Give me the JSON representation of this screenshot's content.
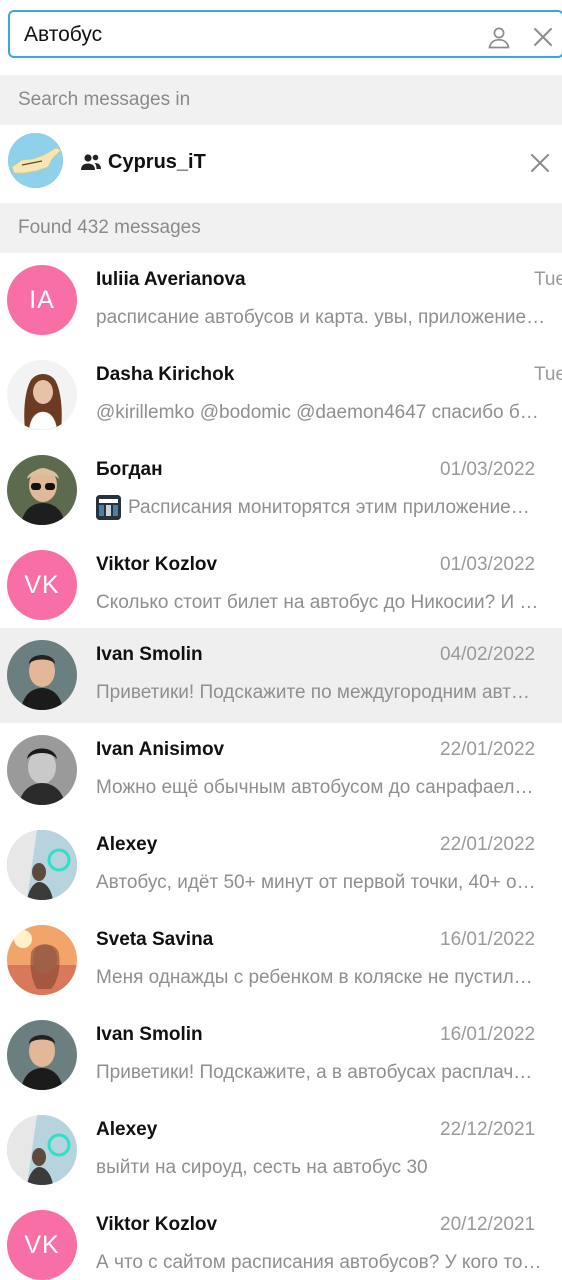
{
  "search": {
    "query": "Автобус",
    "person_icon": "person-icon",
    "clear_icon": "close-icon"
  },
  "search_in": {
    "header": "Search messages in",
    "chat_name": "Cyprus_iT",
    "group_icon": "group-icon",
    "remove_icon": "close-icon"
  },
  "results": {
    "header": "Found 432 messages",
    "items": [
      {
        "name": "Iuliia Averianova",
        "date": "Tue",
        "text": "расписание автобусов и карта. увы, приложение…",
        "avatar": "initials",
        "initials": "IA",
        "avatar_color": "#f76fa5"
      },
      {
        "name": "Dasha Kirichok",
        "date": "Tue",
        "text": "@kirillemko @bodomic @daemon4647 спасибо б…",
        "avatar": "photo"
      },
      {
        "name": "Богдан",
        "date": "01/03/2022",
        "text": "Расписания мониторятся этим приложение…",
        "avatar": "photo",
        "has_thumb": true
      },
      {
        "name": "Viktor Kozlov",
        "date": "01/03/2022",
        "text": "Сколько стоит билет на автобус до Никосии? И …",
        "avatar": "initials",
        "initials": "VK",
        "avatar_color": "#f76fa5"
      },
      {
        "name": "Ivan Smolin",
        "date": "04/02/2022",
        "text": "Приветики! Подскажите по междугородним авт…",
        "avatar": "photo",
        "active": true
      },
      {
        "name": "Ivan Anisimov",
        "date": "22/01/2022",
        "text": "Можно ещё обычным автобусом до санрафаел…",
        "avatar": "photo"
      },
      {
        "name": "Alexey",
        "date": "22/01/2022",
        "text": "Автобус, идёт 50+ минут от первой точки, 40+ о…",
        "avatar": "photo"
      },
      {
        "name": "Sveta Savina",
        "date": "16/01/2022",
        "text": "Меня однажды с ребенком в коляске не пустил…",
        "avatar": "photo"
      },
      {
        "name": "Ivan Smolin",
        "date": "16/01/2022",
        "text": "Приветики! Подскажите, а в автобусах расплач…",
        "avatar": "photo"
      },
      {
        "name": "Alexey",
        "date": "22/12/2021",
        "text": "выйти на сироуд, сесть на автобус 30",
        "avatar": "photo"
      },
      {
        "name": "Viktor Kozlov",
        "date": "20/12/2021",
        "text": "А что с сайтом расписания автобусов? У кого то…",
        "avatar": "initials",
        "initials": "VK",
        "avatar_color": "#f76fa5"
      }
    ]
  },
  "colors": {
    "accent": "#3aa8d8",
    "initials_avatar": "#f76fa5",
    "header_bg": "#f1f1f1",
    "active_row_bg": "#efefef"
  }
}
